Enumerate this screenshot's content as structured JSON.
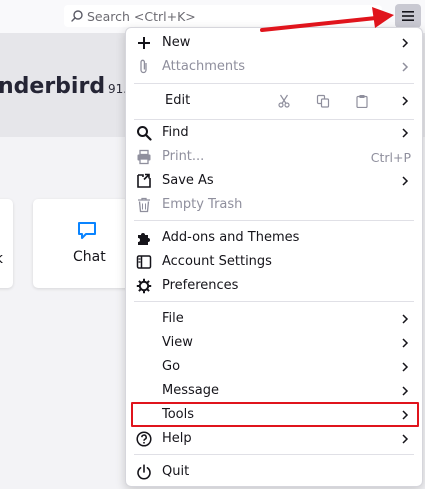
{
  "toolbar": {
    "search_placeholder": "Search <Ctrl+K>",
    "menu_button_icon": "hamburger-menu-icon"
  },
  "start_page": {
    "title_fragment": "nderbird",
    "version_fragment": "91.",
    "left_card_fragment": "k",
    "chat_card_label": "Chat"
  },
  "menu": {
    "new": "New",
    "attachments": "Attachments",
    "edit": "Edit",
    "find": "Find",
    "print": "Print...",
    "print_shortcut": "Ctrl+P",
    "save_as": "Save As",
    "empty_trash": "Empty Trash",
    "addons": "Add-ons and Themes",
    "account_settings": "Account Settings",
    "preferences": "Preferences",
    "file": "File",
    "view": "View",
    "go": "Go",
    "message": "Message",
    "tools": "Tools",
    "help": "Help",
    "quit": "Quit"
  },
  "colors": {
    "annotation_red": "#e0141c",
    "chat_icon_blue": "#0a84ff",
    "menu_button_bg": "#c9c9d2"
  }
}
